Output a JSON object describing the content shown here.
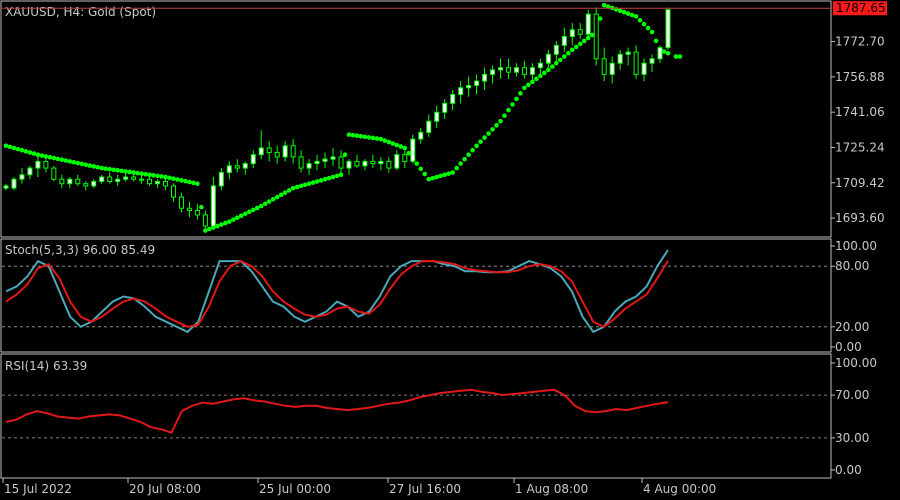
{
  "colors": {
    "background": "#000000",
    "frame": "#c0c0c0",
    "bull_candle": "#ffffff",
    "bear_candle": "#00ff00",
    "sar": "#00ff00",
    "stoch_main": "#4aa8b8",
    "stoch_signal": "#e01818",
    "rsi": "#e01818",
    "level_line": "#a0a0a0",
    "price_line": "#c04040",
    "price_tag": "#ff1a1a",
    "text": "#c8c8c8"
  },
  "main_panel": {
    "title": "XAUUSD, H4:  Gold (Spot)",
    "price_ticks": [
      "1772.70",
      "1756.88",
      "1741.06",
      "1725.24",
      "1709.42",
      "1693.60"
    ],
    "current_price": "1787.65"
  },
  "stoch_panel": {
    "title": "Stoch(5,3,3) 96.00 85.49",
    "ticks": [
      "100.00",
      "80.00",
      "20.00",
      "0.00"
    ]
  },
  "rsi_panel": {
    "title": "RSI(14) 63.39",
    "ticks": [
      "100.00",
      "70.00",
      "30.00",
      "0.00"
    ]
  },
  "time_axis": [
    "15 Jul 2022",
    "20 Jul 08:00",
    "25 Jul 00:00",
    "27 Jul 16:00",
    "1 Aug 08:00",
    "4 Aug 00:00"
  ],
  "chart_data": [
    {
      "type": "candlestick",
      "symbol": "XAUUSD",
      "timeframe": "H4",
      "ylim": [
        1686,
        1790
      ],
      "candles": [
        [
          1707,
          1709,
          1706,
          1708
        ],
        [
          1707,
          1712,
          1706,
          1711
        ],
        [
          1711,
          1716,
          1709,
          1713
        ],
        [
          1713,
          1717,
          1711,
          1716
        ],
        [
          1716,
          1721,
          1712,
          1719
        ],
        [
          1719,
          1722,
          1714,
          1716
        ],
        [
          1716,
          1717,
          1710,
          1711
        ],
        [
          1711,
          1713,
          1707,
          1709
        ],
        [
          1709,
          1712,
          1707,
          1711
        ],
        [
          1711,
          1713,
          1708,
          1709
        ],
        [
          1709,
          1710,
          1706,
          1708
        ],
        [
          1708,
          1711,
          1707,
          1710
        ],
        [
          1710,
          1713,
          1709,
          1712
        ],
        [
          1712,
          1714,
          1709,
          1710
        ],
        [
          1710,
          1713,
          1708,
          1711
        ],
        [
          1711,
          1714,
          1710,
          1712
        ],
        [
          1712,
          1715,
          1710,
          1711
        ],
        [
          1711,
          1713,
          1709,
          1711
        ],
        [
          1711,
          1712,
          1708,
          1709
        ],
        [
          1709,
          1711,
          1707,
          1710
        ],
        [
          1710,
          1713,
          1706,
          1708
        ],
        [
          1708,
          1709,
          1701,
          1703
        ],
        [
          1703,
          1705,
          1696,
          1698
        ],
        [
          1698,
          1701,
          1694,
          1697
        ],
        [
          1697,
          1700,
          1693,
          1695
        ],
        [
          1695,
          1697,
          1688,
          1690
        ],
        [
          1690,
          1712,
          1689,
          1708
        ],
        [
          1708,
          1716,
          1706,
          1714
        ],
        [
          1714,
          1719,
          1711,
          1717
        ],
        [
          1717,
          1720,
          1714,
          1716
        ],
        [
          1716,
          1719,
          1713,
          1718
        ],
        [
          1718,
          1724,
          1716,
          1722
        ],
        [
          1722,
          1733,
          1720,
          1725
        ],
        [
          1725,
          1728,
          1719,
          1723
        ],
        [
          1723,
          1726,
          1718,
          1721
        ],
        [
          1721,
          1728,
          1719,
          1726
        ],
        [
          1726,
          1729,
          1718,
          1721
        ],
        [
          1721,
          1724,
          1714,
          1716
        ],
        [
          1716,
          1720,
          1713,
          1718
        ],
        [
          1718,
          1722,
          1715,
          1719
        ],
        [
          1719,
          1723,
          1716,
          1720
        ],
        [
          1720,
          1725,
          1717,
          1721
        ],
        [
          1721,
          1724,
          1714,
          1716
        ],
        [
          1716,
          1720,
          1713,
          1719
        ],
        [
          1719,
          1722,
          1716,
          1717
        ],
        [
          1717,
          1720,
          1715,
          1719
        ],
        [
          1719,
          1722,
          1716,
          1718
        ],
        [
          1718,
          1721,
          1715,
          1719
        ],
        [
          1719,
          1721,
          1714,
          1716
        ],
        [
          1716,
          1724,
          1715,
          1722
        ],
        [
          1722,
          1726,
          1716,
          1719
        ],
        [
          1719,
          1731,
          1718,
          1729
        ],
        [
          1729,
          1734,
          1727,
          1732
        ],
        [
          1732,
          1740,
          1730,
          1737
        ],
        [
          1737,
          1744,
          1734,
          1741
        ],
        [
          1741,
          1747,
          1738,
          1745
        ],
        [
          1745,
          1751,
          1742,
          1749
        ],
        [
          1749,
          1755,
          1745,
          1752
        ],
        [
          1752,
          1757,
          1748,
          1753
        ],
        [
          1753,
          1758,
          1749,
          1755
        ],
        [
          1755,
          1761,
          1751,
          1758
        ],
        [
          1758,
          1762,
          1754,
          1760
        ],
        [
          1760,
          1765,
          1756,
          1761
        ],
        [
          1761,
          1765,
          1756,
          1759
        ],
        [
          1759,
          1763,
          1757,
          1761
        ],
        [
          1761,
          1764,
          1756,
          1758
        ],
        [
          1758,
          1763,
          1755,
          1761
        ],
        [
          1761,
          1765,
          1758,
          1763
        ],
        [
          1763,
          1769,
          1760,
          1767
        ],
        [
          1767,
          1773,
          1764,
          1771
        ],
        [
          1771,
          1779,
          1768,
          1775
        ],
        [
          1775,
          1781,
          1771,
          1778
        ],
        [
          1778,
          1781,
          1774,
          1776
        ],
        [
          1776,
          1787,
          1775,
          1785
        ],
        [
          1785,
          1788,
          1762,
          1765
        ],
        [
          1765,
          1770,
          1755,
          1758
        ],
        [
          1758,
          1766,
          1754,
          1763
        ],
        [
          1763,
          1769,
          1760,
          1767
        ],
        [
          1767,
          1770,
          1762,
          1768
        ],
        [
          1768,
          1771,
          1756,
          1758
        ],
        [
          1758,
          1765,
          1755,
          1763
        ],
        [
          1763,
          1767,
          1759,
          1765
        ],
        [
          1765,
          1771,
          1763,
          1770
        ],
        [
          1770,
          1788,
          1769,
          1787
        ]
      ],
      "parabolic_sar": [
        [
          0,
          1726
        ],
        [
          4,
          1722
        ],
        [
          8,
          1719
        ],
        [
          12,
          1716
        ],
        [
          16,
          1714
        ],
        [
          20,
          1712
        ],
        [
          24,
          1709
        ],
        [
          25,
          1688
        ],
        [
          28,
          1692
        ],
        [
          32,
          1699
        ],
        [
          36,
          1707
        ],
        [
          40,
          1711
        ],
        [
          42,
          1713
        ],
        [
          43,
          1731
        ],
        [
          47,
          1729
        ],
        [
          50,
          1725
        ],
        [
          53,
          1711
        ],
        [
          56,
          1714
        ],
        [
          59,
          1726
        ],
        [
          62,
          1737
        ],
        [
          65,
          1752
        ],
        [
          68,
          1760
        ],
        [
          71,
          1769
        ],
        [
          74,
          1777
        ],
        [
          75,
          1789
        ],
        [
          79,
          1784
        ],
        [
          81,
          1777
        ],
        [
          82,
          1769
        ],
        [
          84,
          1766
        ]
      ]
    },
    {
      "type": "line",
      "indicator": "Stochastic",
      "ylim": [
        0,
        100
      ],
      "levels": [
        80,
        20
      ],
      "series": [
        {
          "key": "main",
          "values": [
            55,
            60,
            70,
            85,
            80,
            55,
            30,
            20,
            25,
            35,
            45,
            50,
            48,
            40,
            30,
            25,
            20,
            15,
            25,
            55,
            85,
            85,
            85,
            75,
            60,
            45,
            40,
            30,
            25,
            30,
            35,
            45,
            40,
            30,
            35,
            50,
            70,
            80,
            85,
            85,
            85,
            82,
            80,
            75,
            75,
            74,
            74,
            75,
            80,
            85,
            82,
            78,
            70,
            55,
            30,
            15,
            20,
            35,
            45,
            50,
            60,
            80,
            96
          ]
        },
        {
          "key": "signal",
          "values": [
            45,
            52,
            62,
            78,
            82,
            68,
            45,
            30,
            25,
            30,
            38,
            45,
            48,
            45,
            38,
            30,
            25,
            20,
            22,
            40,
            65,
            80,
            85,
            80,
            70,
            55,
            45,
            38,
            32,
            30,
            32,
            38,
            40,
            35,
            33,
            42,
            58,
            72,
            80,
            85,
            85,
            84,
            82,
            78,
            76,
            75,
            74,
            74,
            76,
            80,
            82,
            80,
            75,
            65,
            45,
            25,
            20,
            28,
            38,
            45,
            52,
            68,
            85.49
          ]
        }
      ]
    },
    {
      "type": "line",
      "indicator": "RSI",
      "ylim": [
        0,
        100
      ],
      "levels": [
        70,
        30
      ],
      "series": [
        {
          "key": "rsi",
          "values": [
            45,
            47,
            52,
            55,
            53,
            50,
            49,
            48,
            50,
            51,
            52,
            51,
            48,
            45,
            40,
            38,
            35,
            55,
            60,
            63,
            62,
            64,
            66,
            67,
            65,
            64,
            62,
            60,
            59,
            60,
            60,
            58,
            57,
            56,
            57,
            58,
            60,
            62,
            63,
            65,
            68,
            70,
            72,
            73,
            74,
            75,
            73,
            72,
            70,
            71,
            72,
            73,
            74,
            75,
            70,
            60,
            55,
            54,
            55,
            57,
            56,
            58,
            60,
            62,
            63.39
          ]
        }
      ]
    }
  ]
}
